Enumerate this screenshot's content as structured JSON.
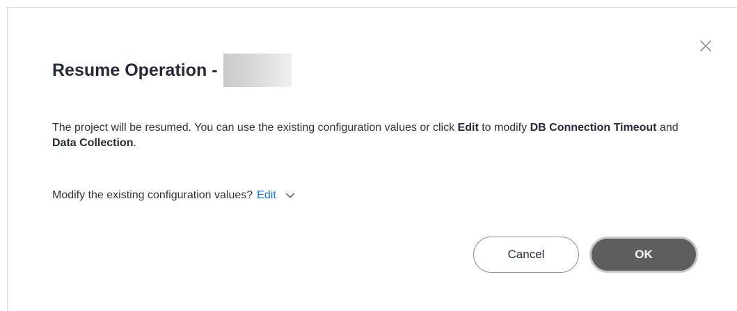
{
  "dialog": {
    "title": "Resume Operation -",
    "close_icon": "close-icon",
    "description": {
      "part1": "The project will be resumed. You can use the existing configuration values or click ",
      "edit_bold": "Edit",
      "part2": " to modify ",
      "timeout_bold": "DB Connection Timeout",
      "part3": " and ",
      "collection_bold": "Data Collection",
      "part4": "."
    },
    "modify_prompt": "Modify the existing configuration values?",
    "edit_link": "Edit",
    "chevron_icon": "chevron-down-icon",
    "cancel_label": "Cancel",
    "ok_label": "OK"
  },
  "colors": {
    "link": "#1a73e8",
    "ok_button": "#5e5e5e",
    "title": "#252b3a"
  }
}
